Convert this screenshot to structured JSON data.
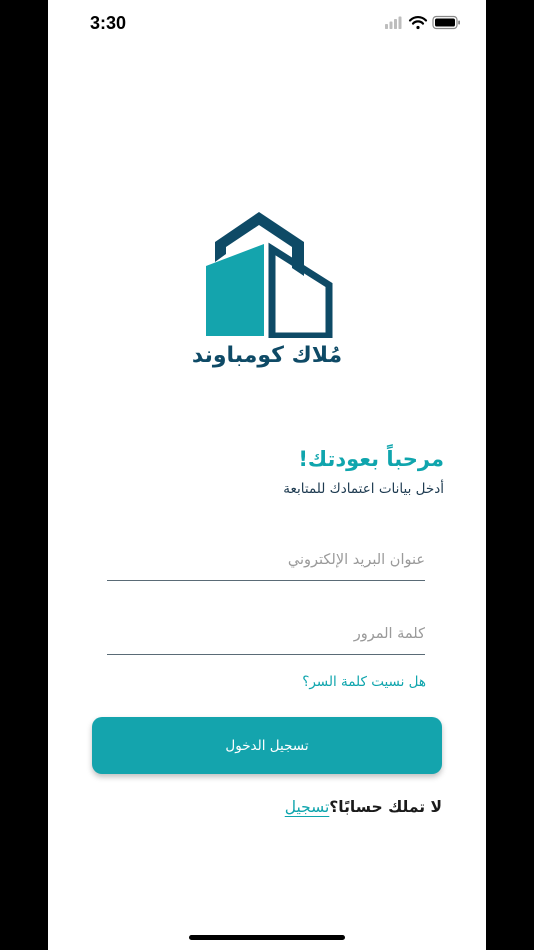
{
  "status_bar": {
    "time": "3:30"
  },
  "brand": {
    "name": "مُلاك كومباوند",
    "colors": {
      "teal": "#14a4ad",
      "navy": "#0e4a66"
    }
  },
  "welcome": {
    "title": "مرحباً بعودتك!",
    "subtitle": "أدخل بيانات اعتمادك للمتابعة"
  },
  "form": {
    "email_placeholder": "عنوان البريد الإلكتروني",
    "password_placeholder": "كلمة المرور",
    "forgot_password": "هل نسيت كلمة السر؟",
    "login_label": "تسجيل الدخول"
  },
  "register": {
    "prompt": "لا تملك حسابًا؟",
    "link": "تسجيل"
  },
  "icons": [
    "signal-icon",
    "wifi-icon",
    "battery-icon",
    "building-logo"
  ]
}
